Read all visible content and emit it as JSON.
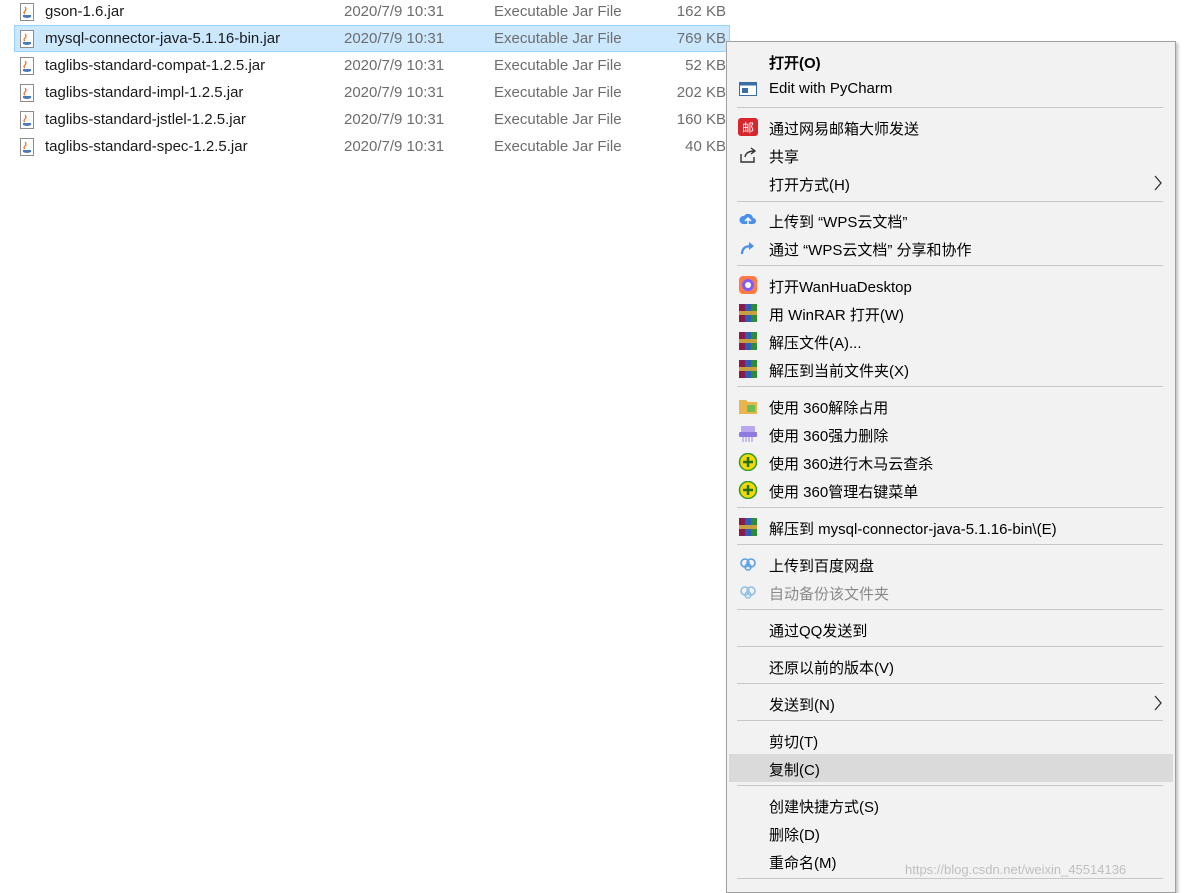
{
  "files": [
    {
      "name": "gson-1.6.jar",
      "date": "2020/7/9 10:31",
      "type": "Executable Jar File",
      "size": "162 KB",
      "selected": false
    },
    {
      "name": "mysql-connector-java-5.1.16-bin.jar",
      "date": "2020/7/9 10:31",
      "type": "Executable Jar File",
      "size": "769 KB",
      "selected": true
    },
    {
      "name": "taglibs-standard-compat-1.2.5.jar",
      "date": "2020/7/9 10:31",
      "type": "Executable Jar File",
      "size": "52 KB",
      "selected": false
    },
    {
      "name": "taglibs-standard-impl-1.2.5.jar",
      "date": "2020/7/9 10:31",
      "type": "Executable Jar File",
      "size": "202 KB",
      "selected": false
    },
    {
      "name": "taglibs-standard-jstlel-1.2.5.jar",
      "date": "2020/7/9 10:31",
      "type": "Executable Jar File",
      "size": "160 KB",
      "selected": false
    },
    {
      "name": "taglibs-standard-spec-1.2.5.jar",
      "date": "2020/7/9 10:31",
      "type": "Executable Jar File",
      "size": "40 KB",
      "selected": false
    }
  ],
  "menu": {
    "open": "打开(O)",
    "edit_pycharm": "Edit with PyCharm",
    "send_netease": "通过网易邮箱大师发送",
    "share": "共享",
    "open_with": "打开方式(H)",
    "upload_wps": "上传到 “WPS云文档”",
    "share_wps": "通过 “WPS云文档” 分享和协作",
    "open_wanhua": "打开WanHuaDesktop",
    "winrar_open": "用 WinRAR 打开(W)",
    "extract_files": "解压文件(A)...",
    "extract_here": "解压到当前文件夹(X)",
    "release_360": "使用 360解除占用",
    "force_delete_360": "使用 360强力删除",
    "trojan_scan_360": "使用 360进行木马云查杀",
    "manage_menu_360": "使用 360管理右键菜单",
    "extract_to_folder": "解压到 mysql-connector-java-5.1.16-bin\\(E)",
    "upload_baidu": "上传到百度网盘",
    "auto_backup": "自动备份该文件夹",
    "send_qq": "通过QQ发送到",
    "restore_version": "还原以前的版本(V)",
    "send_to": "发送到(N)",
    "cut": "剪切(T)",
    "copy": "复制(C)",
    "create_shortcut": "创建快捷方式(S)",
    "delete": "删除(D)",
    "rename": "重命名(M)"
  },
  "watermark": "https://blog.csdn.net/weixin_45514136",
  "colors": {
    "selection_bg": "#cce8ff",
    "menu_bg": "#f2f2f2",
    "menu_highlight": "#dadada"
  }
}
